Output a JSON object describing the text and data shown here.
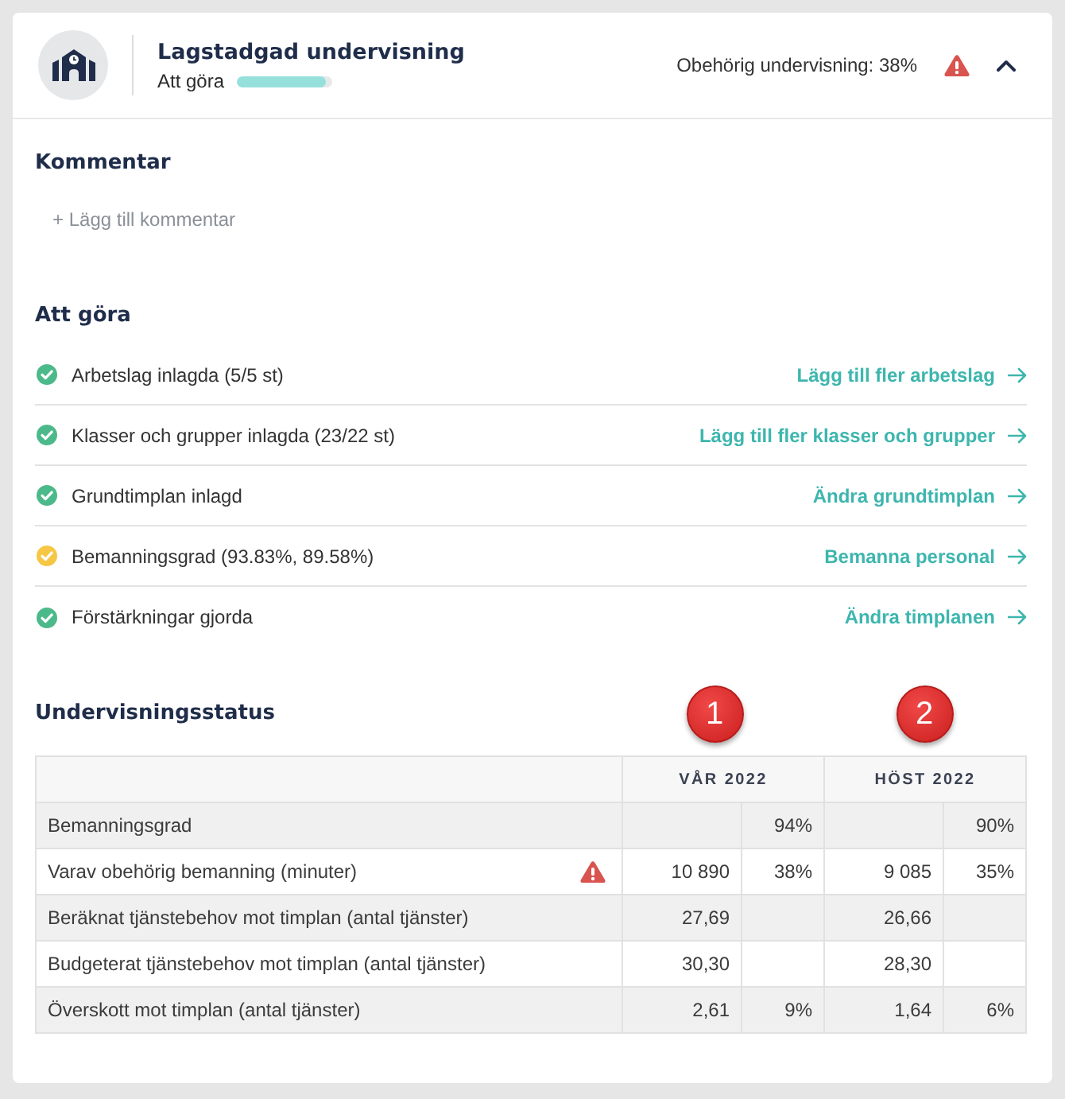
{
  "header": {
    "title": "Lagstadgad undervisning",
    "subtitle": "Att göra",
    "progress": {
      "level": 0.93
    },
    "summary": "Obehörig undervisning: 38%",
    "warning": true,
    "expanded": true
  },
  "comments": {
    "heading": "Kommentar",
    "add_link": "+ Lägg till kommentar"
  },
  "todo": {
    "heading": "Att göra",
    "items": [
      {
        "label": "Arbetslag inlagda (5/5 st)",
        "complete": true,
        "action": "Lägg till fler arbetslag"
      },
      {
        "label": "Klasser och grupper inlagda (23/22 st)",
        "complete": true,
        "action": "Lägg till fler klasser och grupper"
      },
      {
        "label": "Grundtimplan inlagd",
        "complete": true,
        "action": "Ändra grundtimplan"
      },
      {
        "label": "Bemanningsgrad (93.83%, 89.58%)",
        "complete": false,
        "action": "Bemanna personal"
      },
      {
        "label": "Förstärkningar gjorda",
        "complete": true,
        "action": "Ändra timplanen"
      }
    ]
  },
  "teaching_status": {
    "heading": "Undervisningsstatus",
    "markers": [
      {
        "label": "1"
      },
      {
        "label": "2"
      }
    ],
    "table": {
      "periods": [
        "VÅR 2022",
        "HÖST 2022"
      ],
      "rows": [
        {
          "label": "Bemanningsgrad",
          "warning": false,
          "values": [
            {
              "share": "94%"
            },
            {
              "share": "90%"
            }
          ]
        },
        {
          "label": "Varav obehörig bemanning (minuter)",
          "warning": true,
          "values": [
            {
              "amount": "10 890",
              "share": "38%"
            },
            {
              "amount": "9 085",
              "share": "35%"
            }
          ]
        },
        {
          "label": "Beräknat tjänstebehov mot timplan (antal tjänster)",
          "warning": false,
          "values": [
            {
              "amount": "27,69"
            },
            {
              "amount": "26,66"
            }
          ]
        },
        {
          "label": "Budgeterat tjänstebehov mot timplan (antal tjänster)",
          "warning": false,
          "values": [
            {
              "amount": "30,30"
            },
            {
              "amount": "28,30"
            }
          ]
        },
        {
          "label": "Överskott mot timplan (antal tjänster)",
          "warning": false,
          "values": [
            {
              "amount": "2,61",
              "share": "9%"
            },
            {
              "amount": "1,64",
              "share": "6%"
            }
          ]
        }
      ]
    }
  }
}
